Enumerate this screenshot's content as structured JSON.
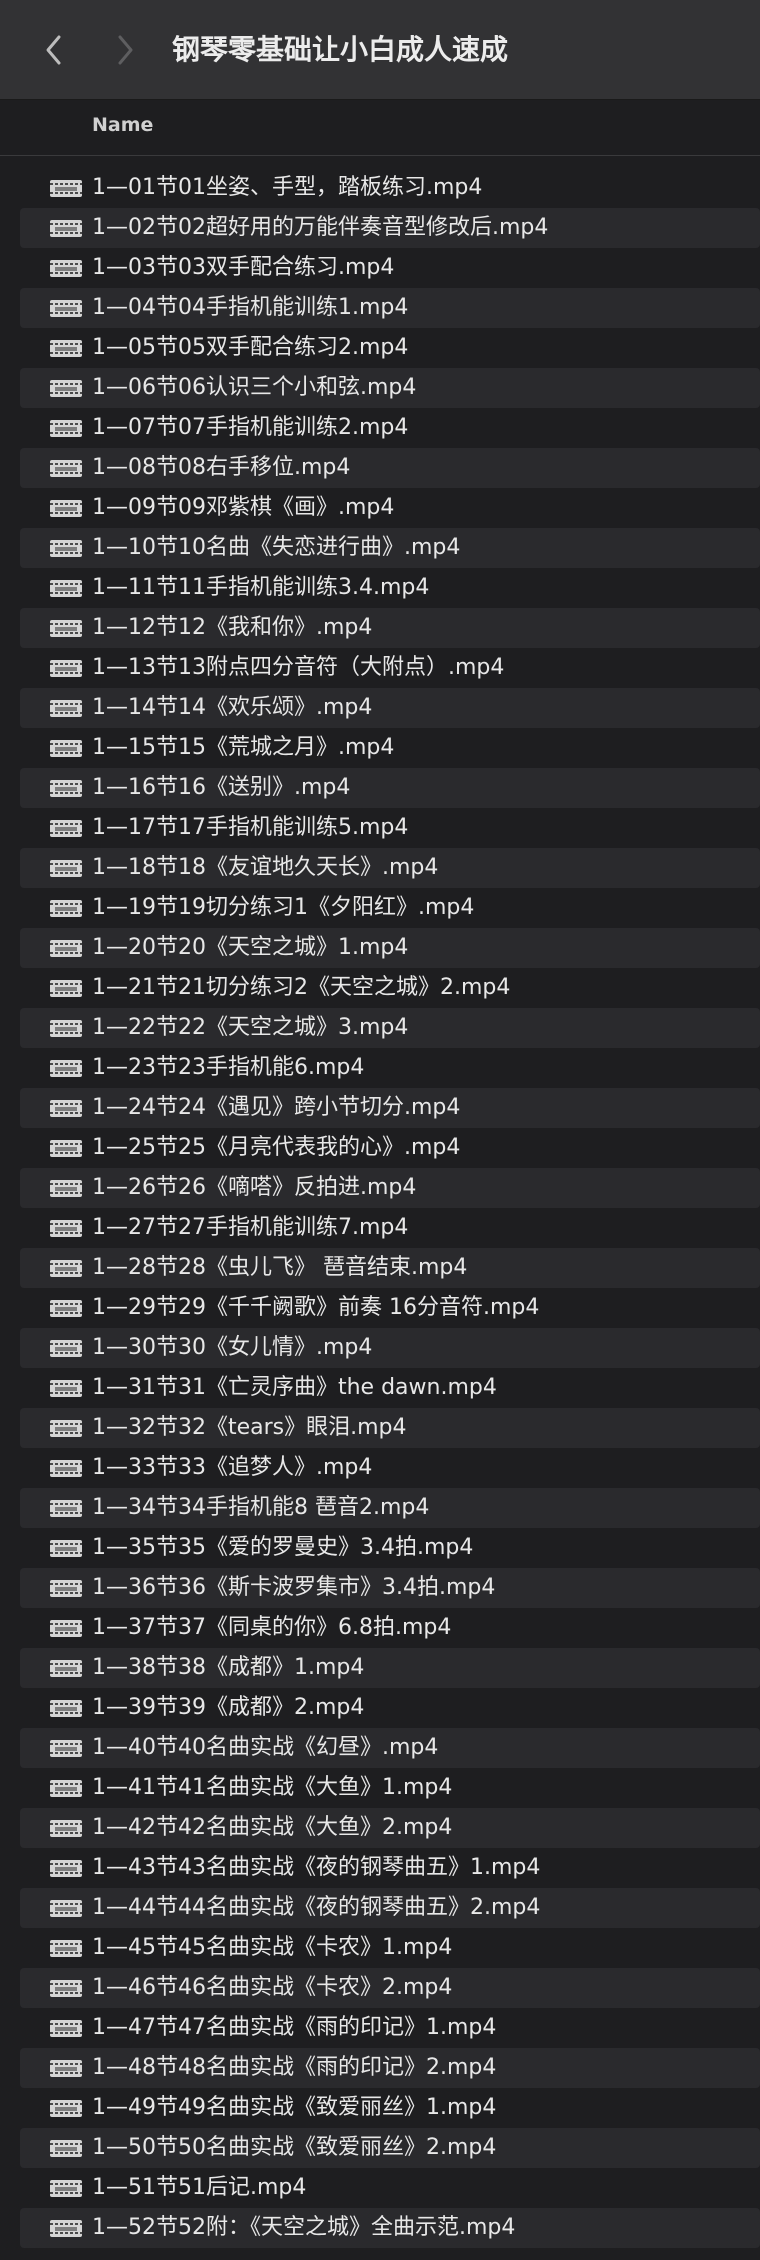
{
  "window": {
    "title": "钢琴零基础让小白成人速成",
    "back_glyph": "‹",
    "forward_glyph": "›"
  },
  "columns": {
    "name": "Name"
  },
  "files": [
    "1—01节01坐姿、手型，踏板练习.mp4",
    "1—02节02超好用的万能伴奏音型修改后.mp4",
    "1—03节03双手配合练习.mp4",
    "1—04节04手指机能训练1.mp4",
    "1—05节05双手配合练习2.mp4",
    "1—06节06认识三个小和弦.mp4",
    "1—07节07手指机能训练2.mp4",
    "1—08节08右手移位.mp4",
    "1—09节09邓紫棋《画》.mp4",
    "1—10节10名曲《失恋进行曲》.mp4",
    "1—11节11手指机能训练3.4.mp4",
    "1—12节12《我和你》.mp4",
    "1—13节13附点四分音符（大附点）.mp4",
    "1—14节14《欢乐颂》.mp4",
    "1—15节15《荒城之月》.mp4",
    "1—16节16《送别》.mp4",
    "1—17节17手指机能训练5.mp4",
    "1—18节18《友谊地久天长》.mp4",
    "1—19节19切分练习1《夕阳红》.mp4",
    "1—20节20《天空之城》1.mp4",
    "1—21节21切分练习2《天空之城》2.mp4",
    "1—22节22《天空之城》3.mp4",
    "1—23节23手指机能6.mp4",
    "1—24节24《遇见》跨小节切分.mp4",
    "1—25节25《月亮代表我的心》.mp4",
    "1—26节26《嘀嗒》反拍进.mp4",
    "1—27节27手指机能训练7.mp4",
    "1—28节28《虫儿飞》 琶音结束.mp4",
    "1—29节29《千千阙歌》前奏 16分音符.mp4",
    "1—30节30《女儿情》.mp4",
    "1—31节31《亡灵序曲》the dawn.mp4",
    "1—32节32《tears》眼泪.mp4",
    "1—33节33《追梦人》.mp4",
    "1—34节34手指机能8 琶音2.mp4",
    "1—35节35《爱的罗曼史》3.4拍.mp4",
    "1—36节36《斯卡波罗集市》3.4拍.mp4",
    "1—37节37《同桌的你》6.8拍.mp4",
    "1—38节38《成都》1.mp4",
    "1—39节39《成都》2.mp4",
    "1—40节40名曲实战《幻昼》.mp4",
    "1—41节41名曲实战《大鱼》1.mp4",
    "1—42节42名曲实战《大鱼》2.mp4",
    "1—43节43名曲实战《夜的钢琴曲五》1.mp4",
    "1—44节44名曲实战《夜的钢琴曲五》2.mp4",
    "1—45节45名曲实战《卡农》1.mp4",
    "1—46节46名曲实战《卡农》2.mp4",
    "1—47节47名曲实战《雨的印记》1.mp4",
    "1—48节48名曲实战《雨的印记》2.mp4",
    "1—49节49名曲实战《致爱丽丝》1.mp4",
    "1—50节50名曲实战《致爱丽丝》2.mp4",
    "1—51节51后记.mp4",
    "1—52节52附：《天空之城》全曲示范.mp4"
  ]
}
